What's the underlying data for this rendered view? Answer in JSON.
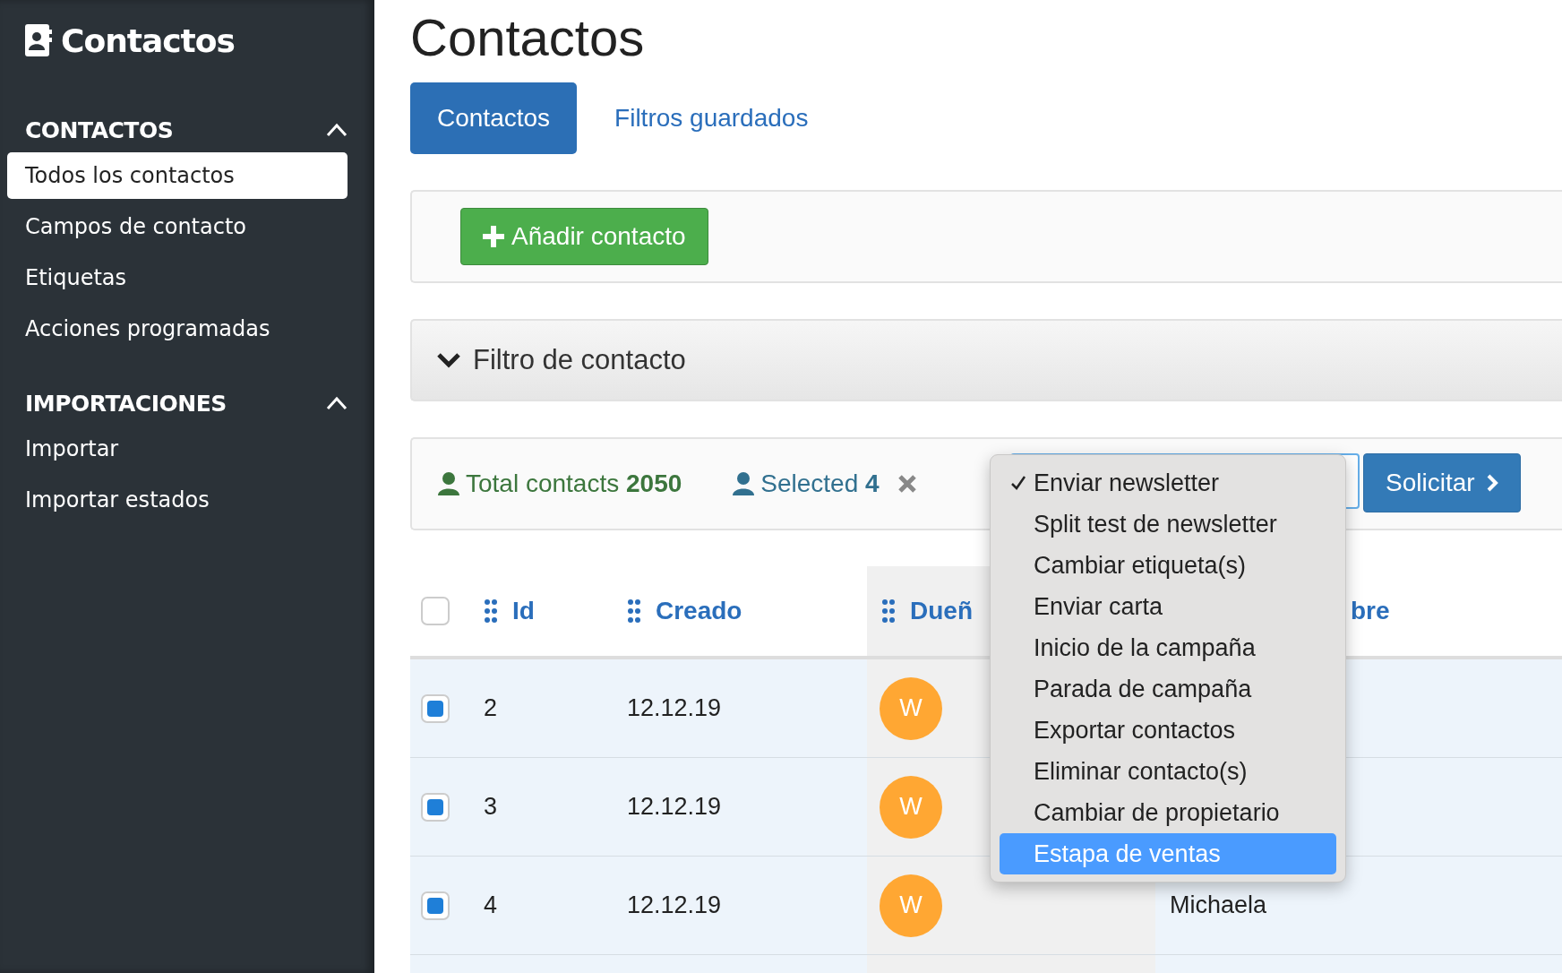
{
  "sidebar": {
    "title": "Contactos",
    "sections": [
      {
        "title": "CONTACTOS",
        "expanded": true,
        "items": [
          {
            "label": "Todos los contactos",
            "selected": true
          },
          {
            "label": "Campos de contacto",
            "selected": false
          },
          {
            "label": "Etiquetas",
            "selected": false
          },
          {
            "label": "Acciones programadas",
            "selected": false
          }
        ]
      },
      {
        "title": "IMPORTACIONES",
        "expanded": true,
        "items": [
          {
            "label": "Importar",
            "selected": false
          },
          {
            "label": "Importar estados",
            "selected": false
          }
        ]
      }
    ]
  },
  "page_title": "Contactos",
  "tabs": [
    {
      "label": "Contactos",
      "selected": true
    },
    {
      "label": "Filtros guardados",
      "selected": false
    }
  ],
  "add_button": "Añadir contacto",
  "filter_panel": {
    "title": "Filtro de contacto"
  },
  "summary": {
    "total_label": "Total contacts",
    "total": "2050",
    "selected_label": "Selected",
    "selected_count": "4"
  },
  "apply_button": "Solicitar",
  "action_menu": [
    {
      "label": "Enviar newsletter",
      "checked": true,
      "highlighted": false
    },
    {
      "label": "Split test de newsletter",
      "checked": false,
      "highlighted": false
    },
    {
      "label": "Cambiar etiqueta(s)",
      "checked": false,
      "highlighted": false
    },
    {
      "label": "Enviar carta",
      "checked": false,
      "highlighted": false
    },
    {
      "label": "Inicio de la campaña",
      "checked": false,
      "highlighted": false
    },
    {
      "label": "Parada de campaña",
      "checked": false,
      "highlighted": false
    },
    {
      "label": "Exportar contactos",
      "checked": false,
      "highlighted": false
    },
    {
      "label": "Eliminar contacto(s)",
      "checked": false,
      "highlighted": false
    },
    {
      "label": "Cambiar de propietario",
      "checked": false,
      "highlighted": false
    },
    {
      "label": "Estapa de ventas",
      "checked": false,
      "highlighted": true
    }
  ],
  "table": {
    "select_all_checked": false,
    "columns": [
      {
        "label": "Id"
      },
      {
        "label": "Creado"
      },
      {
        "label": "Dueñ"
      },
      {
        "label": "bre"
      }
    ],
    "rows": [
      {
        "checked": true,
        "id": "2",
        "created": "12.12.19",
        "owner": "W"
      },
      {
        "checked": true,
        "id": "3",
        "created": "12.12.19",
        "owner": "W"
      },
      {
        "checked": true,
        "id": "4",
        "created": "12.12.19",
        "owner": "W",
        "name": "Michaela"
      }
    ]
  }
}
